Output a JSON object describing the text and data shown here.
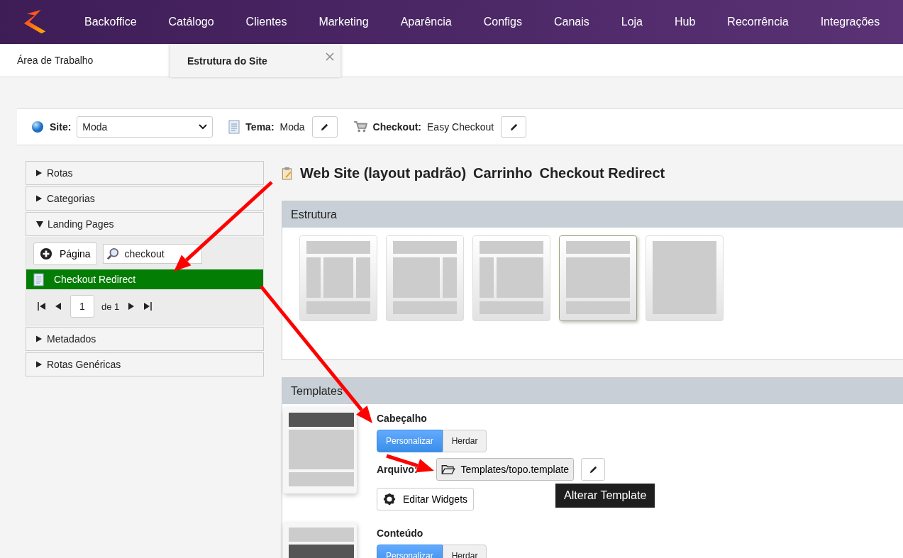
{
  "nav": {
    "items": [
      "Backoffice",
      "Catálogo",
      "Clientes",
      "Marketing",
      "Aparência",
      "Configs",
      "Canais",
      "Loja",
      "Hub",
      "Recorrência",
      "Integrações"
    ]
  },
  "tabs": [
    {
      "label": "Área de Trabalho",
      "selected": false,
      "closable": false
    },
    {
      "label": "Estrutura do Site",
      "selected": true,
      "closable": true
    }
  ],
  "toolbar": {
    "site": {
      "label": "Site:",
      "value": "Moda"
    },
    "theme": {
      "label": "Tema:",
      "value": "Moda"
    },
    "checkout": {
      "label": "Checkout:",
      "value": "Easy Checkout"
    }
  },
  "sidebar": {
    "sections": [
      {
        "label": "Rotas",
        "expanded": false
      },
      {
        "label": "Categorias",
        "expanded": false
      },
      {
        "label": "Landing Pages",
        "expanded": true,
        "add_button": "Página",
        "search": "checkout",
        "items": [
          {
            "label": "Checkout Redirect",
            "selected": true
          }
        ],
        "pager": {
          "page": "1",
          "of": "de 1"
        }
      },
      {
        "label": "Metadados",
        "expanded": false
      },
      {
        "label": "Rotas Genéricas",
        "expanded": false
      }
    ]
  },
  "breadcrumb": [
    "Web Site (layout padrão)",
    "Carrinho",
    "Checkout Redirect"
  ],
  "structure": {
    "title": "Estrutura",
    "layouts": [
      {
        "kind": "three-column",
        "selected": false
      },
      {
        "kind": "right-sidebar",
        "selected": false
      },
      {
        "kind": "left-sidebar",
        "selected": false
      },
      {
        "kind": "single-column",
        "selected": true
      },
      {
        "kind": "blank",
        "selected": false
      }
    ]
  },
  "templates": {
    "title": "Templates",
    "sections": [
      {
        "title": "Cabeçalho",
        "kind": "header",
        "modes": [
          {
            "label": "Personalizar",
            "selected": true
          },
          {
            "label": "Herdar",
            "selected": false
          }
        ],
        "file_label": "Arquivo:",
        "file": "Templates/topo.template",
        "widgets_button": "Editar Widgets",
        "tooltip": "Alterar Template"
      },
      {
        "title": "Conteúdo",
        "kind": "content",
        "modes": [
          {
            "label": "Personalizar",
            "selected": true
          },
          {
            "label": "Herdar",
            "selected": false
          }
        ]
      }
    ]
  }
}
